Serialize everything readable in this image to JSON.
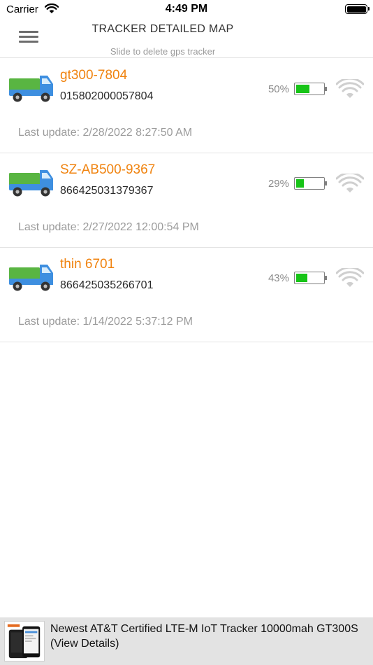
{
  "status_bar": {
    "carrier": "Carrier",
    "time": "4:49 PM"
  },
  "nav": {
    "title": "TRACKER DETAILED MAP",
    "subtitle": "Slide to delete gps tracker"
  },
  "colors": {
    "accent": "#f0830f",
    "battery_fill": "#17c417",
    "truck_cab": "#3e8fe0",
    "truck_cargo": "#59b542",
    "signal": "#cfcfcf"
  },
  "trackers": [
    {
      "name": "gt300-7804",
      "imei": "015802000057804",
      "battery": "50%",
      "battery_level": 0.5,
      "last_update": "Last update: 2/28/2022 8:27:50 AM"
    },
    {
      "name": "SZ-AB500-9367",
      "imei": "866425031379367",
      "battery": "29%",
      "battery_level": 0.29,
      "last_update": "Last update: 2/27/2022 12:00:54 PM"
    },
    {
      "name": "thin 6701",
      "imei": "866425035266701",
      "battery": "43%",
      "battery_level": 0.43,
      "last_update": "Last update: 1/14/2022 5:37:12 PM"
    }
  ],
  "icons": {
    "menu": "hamburger-menu-icon",
    "tracker": "truck-icon",
    "signal": "wifi-signal-icon"
  },
  "ad": {
    "text": "Newest AT&T Certified LTE-M IoT Tracker 10000mah GT300S (View Details)"
  }
}
